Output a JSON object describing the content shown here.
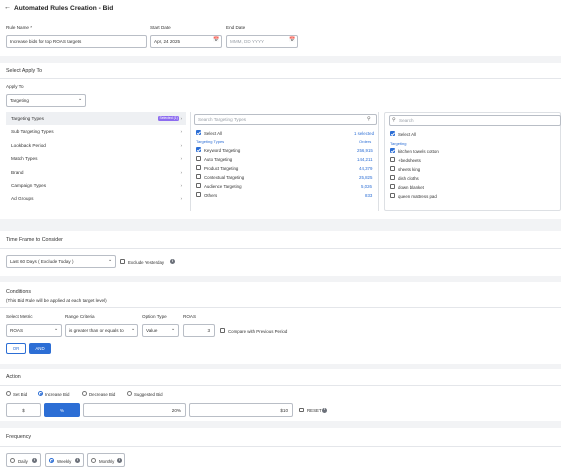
{
  "header": {
    "back_icon": "arrow-left-icon",
    "title": "Automated Rules Creation - Bid"
  },
  "rule": {
    "name_label": "Rule Name *",
    "name_value": "Increase bids for top ROAS targets",
    "start_label": "Start Date",
    "start_value": "Apr, 24 2025",
    "end_label": "End Date",
    "end_placeholder": "MMM, DD YYYY"
  },
  "apply": {
    "section_title": "Select Apply To",
    "apply_to_label": "Apply To",
    "apply_to_value": "Targeting",
    "menu": [
      {
        "label": "Targeting Types",
        "badge": "Selected (1)",
        "active": true
      },
      {
        "label": "Sub Targeting Types"
      },
      {
        "label": "Lookback Period"
      },
      {
        "label": "Match Types"
      },
      {
        "label": "Brand"
      },
      {
        "label": "Campaign Types"
      },
      {
        "label": "Ad Groups"
      }
    ],
    "middle": {
      "search_placeholder": "Search Targeting Types",
      "select_all": "Select All",
      "selected_count": "1 selected",
      "col_left": "Targeting Types",
      "col_right": "Orders",
      "rows": [
        {
          "label": "Keyword Targeting",
          "value": "256,915",
          "checked": true
        },
        {
          "label": "Auto Targeting",
          "value": "144,211",
          "checked": false
        },
        {
          "label": "Product Targeting",
          "value": "44,379",
          "checked": false
        },
        {
          "label": "Contextual Targeting",
          "value": "25,825",
          "checked": false
        },
        {
          "label": "Audience Targeting",
          "value": "5,026",
          "checked": false
        },
        {
          "label": "Others",
          "value": "833",
          "checked": false
        }
      ]
    },
    "right": {
      "search_placeholder": "Search",
      "select_all": "Select All",
      "group_label": "Targeting",
      "rows": [
        {
          "label": "kitchen towels cotton",
          "checked": true
        },
        {
          "label": "+bedsheets",
          "checked": false
        },
        {
          "label": "sheets king",
          "checked": false
        },
        {
          "label": "dish cloths",
          "checked": false
        },
        {
          "label": "down blanket",
          "checked": false
        },
        {
          "label": "queen mattress pad",
          "checked": false
        }
      ]
    }
  },
  "timeframe": {
    "section_title": "Time Frame to Consider",
    "value": "Last 60 Days ( Exclude Today )",
    "exclude_label": "Exclude Yesterday"
  },
  "conditions": {
    "section_title": "Conditions",
    "subtitle": "(This Bid Rule will be applied at each target level)",
    "metric_label": "Select Metric",
    "metric_value": "ROAS",
    "criteria_label": "Range Criteria",
    "criteria_value": "is greater than or equals to",
    "option_label": "Option Type",
    "option_value": "Value",
    "roas_label": "ROAS",
    "roas_value": "3",
    "compare_label": "Compare with Previous Period",
    "or_label": "OR",
    "and_label": "AND"
  },
  "action": {
    "section_title": "Action",
    "options": [
      {
        "label": "Set Bid",
        "on": false
      },
      {
        "label": "Increase Bid",
        "on": true
      },
      {
        "label": "Decrease Bid",
        "on": false
      },
      {
        "label": "Suggested Bid",
        "on": false
      }
    ],
    "dollar_label": "$",
    "percent_label": "%",
    "percent_value": "20%",
    "cap_value": "$10",
    "reset_label": "RESET"
  },
  "frequency": {
    "section_title": "Frequency",
    "options": [
      {
        "label": "Daily",
        "on": false
      },
      {
        "label": "Weekly",
        "on": true
      },
      {
        "label": "Monthly",
        "on": false
      }
    ]
  },
  "colors": {
    "accent": "#2c6ed5",
    "badge": "#8d6cf0",
    "bg": "#f2f3f5"
  }
}
